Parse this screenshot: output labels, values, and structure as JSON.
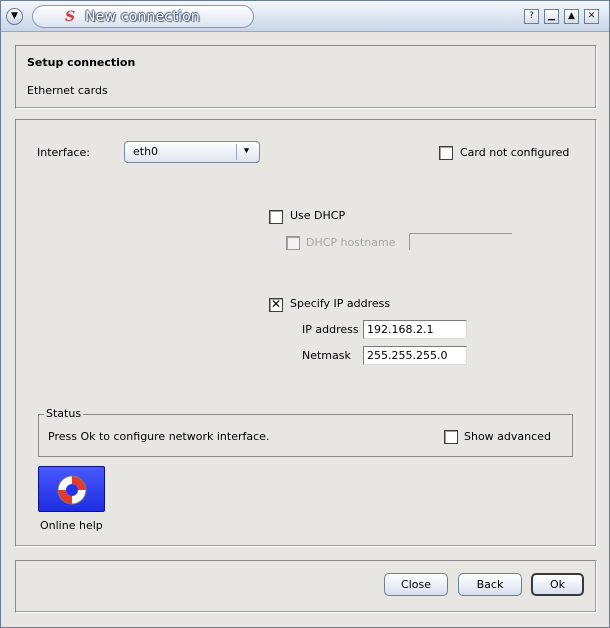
{
  "window": {
    "title": "New connection",
    "logo_letter": "S"
  },
  "header": {
    "title": "Setup connection",
    "subtitle": "Ethernet cards"
  },
  "interface": {
    "label": "Interface:",
    "selected": "eth0",
    "card_not_configured_label": "Card not configured",
    "card_not_configured_checked": false
  },
  "dhcp": {
    "use_dhcp_label": "Use DHCP",
    "use_dhcp_checked": false,
    "hostname_label": "DHCP hostname",
    "hostname_checked": false,
    "hostname_value": ""
  },
  "ip": {
    "specify_label": "Specify IP address",
    "specify_checked": true,
    "check_glyph": "✕",
    "address_label": "IP address",
    "address_value": "192.168.2.1",
    "netmask_label": "Netmask",
    "netmask_value": "255.255.255.0"
  },
  "status": {
    "legend": "Status",
    "message": "Press Ok to configure network interface.",
    "show_advanced_label": "Show advanced",
    "show_advanced_checked": false
  },
  "help": {
    "label": "Online help",
    "icon": "lifebuoy-icon"
  },
  "buttons": {
    "close": "Close",
    "back": "Back",
    "ok": "Ok"
  },
  "colors": {
    "help_button": "#2432f0",
    "title_logo": "#d8383a"
  }
}
